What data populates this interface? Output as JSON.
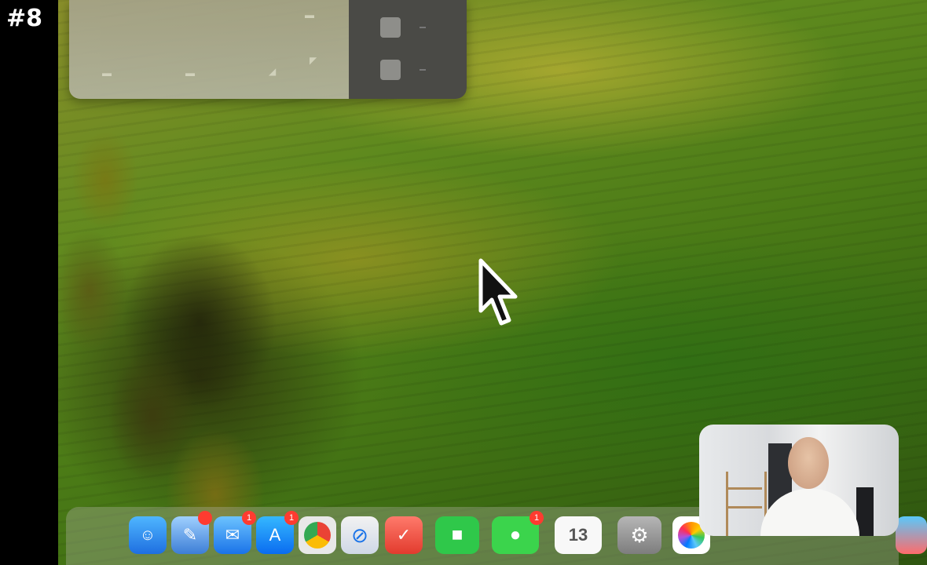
{
  "clip_label": "#8",
  "dock": {
    "items": [
      {
        "name": "finder",
        "badge": ""
      },
      {
        "name": "app-2",
        "badge": ""
      },
      {
        "name": "mail",
        "badge": "1"
      },
      {
        "name": "app-store",
        "badge": "1"
      },
      {
        "name": "chrome",
        "badge": ""
      },
      {
        "name": "safari",
        "badge": ""
      },
      {
        "name": "app-7",
        "badge": ""
      },
      {
        "name": "facetime",
        "badge": ""
      },
      {
        "name": "messages",
        "badge": "1"
      },
      {
        "name": "calendar",
        "badge": "",
        "text": "13"
      },
      {
        "name": "system-settings",
        "badge": ""
      },
      {
        "name": "photos",
        "badge": ""
      }
    ]
  },
  "colors": {
    "badge": "#ff3b30",
    "facetime": "#2fc84a",
    "messages": "#3bd44c"
  }
}
